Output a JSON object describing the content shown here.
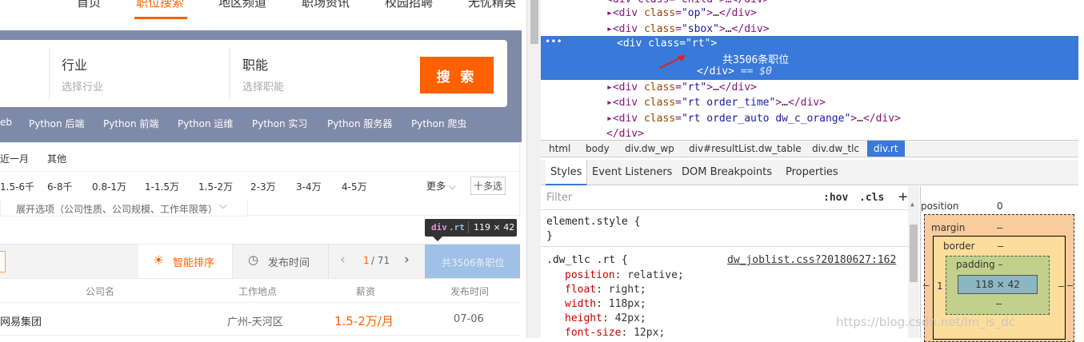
{
  "nav": {
    "items": [
      "首页",
      "职位搜索",
      "地区频道",
      "职场资讯",
      "校园招聘",
      "无忧精英"
    ],
    "active": 1
  },
  "search": {
    "industry_label": "行业",
    "industry_placeholder": "选择行业",
    "function_label": "职能",
    "function_placeholder": "选择职能",
    "button": "搜 索"
  },
  "tags": [
    "eb",
    "Python 后端",
    "Python 前端",
    "Python 运维",
    "Python 实习",
    "Python 服务器",
    "Python 爬虫"
  ],
  "filter": {
    "time": [
      "近一月",
      "其他"
    ],
    "salary": [
      "1.5-6千",
      "6-8千",
      "0.8-1万",
      "1-1.5万",
      "1.5-2万",
      "2-3万",
      "3-4万",
      "4-5万"
    ],
    "more": "更多",
    "multi": "十多选",
    "expand": "展开选项（公司性质、公司规模、工作年限等）"
  },
  "tooltip": {
    "tag": "div",
    "cls": ".rt",
    "size": "119 × 42"
  },
  "sortbar": {
    "smart": "智能排序",
    "time": "发布时间",
    "page_current": "1",
    "page_total": "/ 71",
    "total": "共3506条职位"
  },
  "table": {
    "headers": [
      "公司名",
      "工作地点",
      "薪资",
      "发布时间"
    ],
    "row": {
      "company": "网易集团",
      "location": "广州-天河区",
      "salary": "1.5-2万/月",
      "date": "07-06"
    }
  },
  "devtools": {
    "dom": [
      {
        "cls": "op"
      },
      {
        "cls": "sbox"
      },
      {
        "cls": "rt",
        "selected": true,
        "text": "共3506条职位",
        "suffix": "== $0"
      },
      {
        "cls": "rt"
      },
      {
        "cls": "rt order_time"
      },
      {
        "cls": "rt order_auto dw_c_orange"
      }
    ],
    "crumbs": [
      "html",
      "body",
      "div.dw_wp",
      "div#resultList.dw_table",
      "div.dw_tlc",
      "div.rt"
    ],
    "tabs": [
      "Styles",
      "Event Listeners",
      "DOM Breakpoints",
      "Properties"
    ],
    "filter_placeholder": "Filter",
    "hov": ":hov",
    "cls": ".cls",
    "element_style": "element.style {",
    "rule": {
      "selector": ".dw_tlc .rt {",
      "source": "dw_joblist.css?20180627:162"
    },
    "props": [
      {
        "name": "position",
        "value": "relative;"
      },
      {
        "name": "float",
        "value": "right;"
      },
      {
        "name": "width",
        "value": "118px;"
      },
      {
        "name": "height",
        "value": "42px;"
      },
      {
        "name": "font-size",
        "value": "12px;"
      }
    ],
    "boxmodel": {
      "position": "position",
      "position_val": "0",
      "margin": "margin",
      "border": "border",
      "padding": "padding",
      "content": "118 × 42",
      "dash": "–",
      "left_val": "1"
    }
  },
  "watermark": "https://blog.csdn.net/lm_is_dc"
}
